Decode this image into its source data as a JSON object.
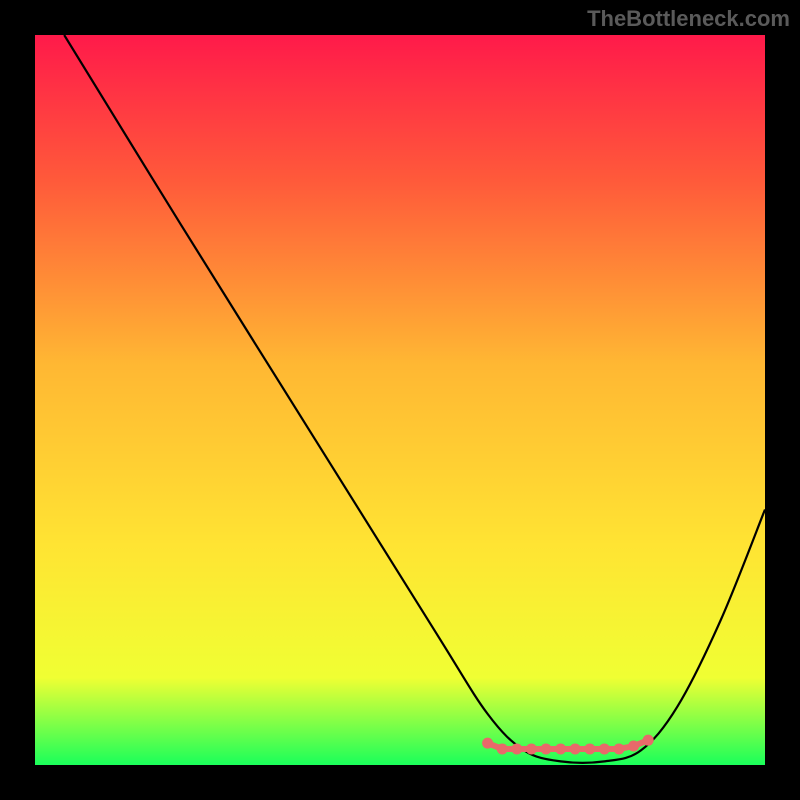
{
  "watermark": "TheBottleneck.com",
  "chart_data": {
    "type": "line",
    "title": "",
    "xlabel": "",
    "ylabel": "",
    "xlim": [
      0,
      100
    ],
    "ylim": [
      0,
      100
    ],
    "gradient_stops": [
      {
        "offset": 0,
        "color": "#ff1a4a"
      },
      {
        "offset": 20,
        "color": "#ff5a3a"
      },
      {
        "offset": 45,
        "color": "#ffb733"
      },
      {
        "offset": 70,
        "color": "#ffe433"
      },
      {
        "offset": 88,
        "color": "#f0ff33"
      },
      {
        "offset": 100,
        "color": "#1aff5a"
      }
    ],
    "series": [
      {
        "name": "bottleneck-curve",
        "color": "#000000",
        "width": 2.2,
        "points": [
          {
            "x": 4,
            "y": 100
          },
          {
            "x": 20,
            "y": 74
          },
          {
            "x": 40,
            "y": 42
          },
          {
            "x": 55,
            "y": 18
          },
          {
            "x": 62,
            "y": 7
          },
          {
            "x": 67,
            "y": 2
          },
          {
            "x": 72,
            "y": 0.5
          },
          {
            "x": 78,
            "y": 0.5
          },
          {
            "x": 83,
            "y": 2
          },
          {
            "x": 88,
            "y": 8
          },
          {
            "x": 94,
            "y": 20
          },
          {
            "x": 100,
            "y": 35
          }
        ]
      }
    ],
    "markers": {
      "name": "bottom-markers",
      "color": "#e86a6a",
      "points": [
        {
          "x": 62,
          "y": 3.0
        },
        {
          "x": 64,
          "y": 2.2
        },
        {
          "x": 66,
          "y": 2.2
        },
        {
          "x": 68,
          "y": 2.2
        },
        {
          "x": 70,
          "y": 2.2
        },
        {
          "x": 72,
          "y": 2.2
        },
        {
          "x": 74,
          "y": 2.2
        },
        {
          "x": 76,
          "y": 2.2
        },
        {
          "x": 78,
          "y": 2.2
        },
        {
          "x": 80,
          "y": 2.2
        },
        {
          "x": 82,
          "y": 2.6
        },
        {
          "x": 84,
          "y": 3.4
        }
      ]
    }
  }
}
